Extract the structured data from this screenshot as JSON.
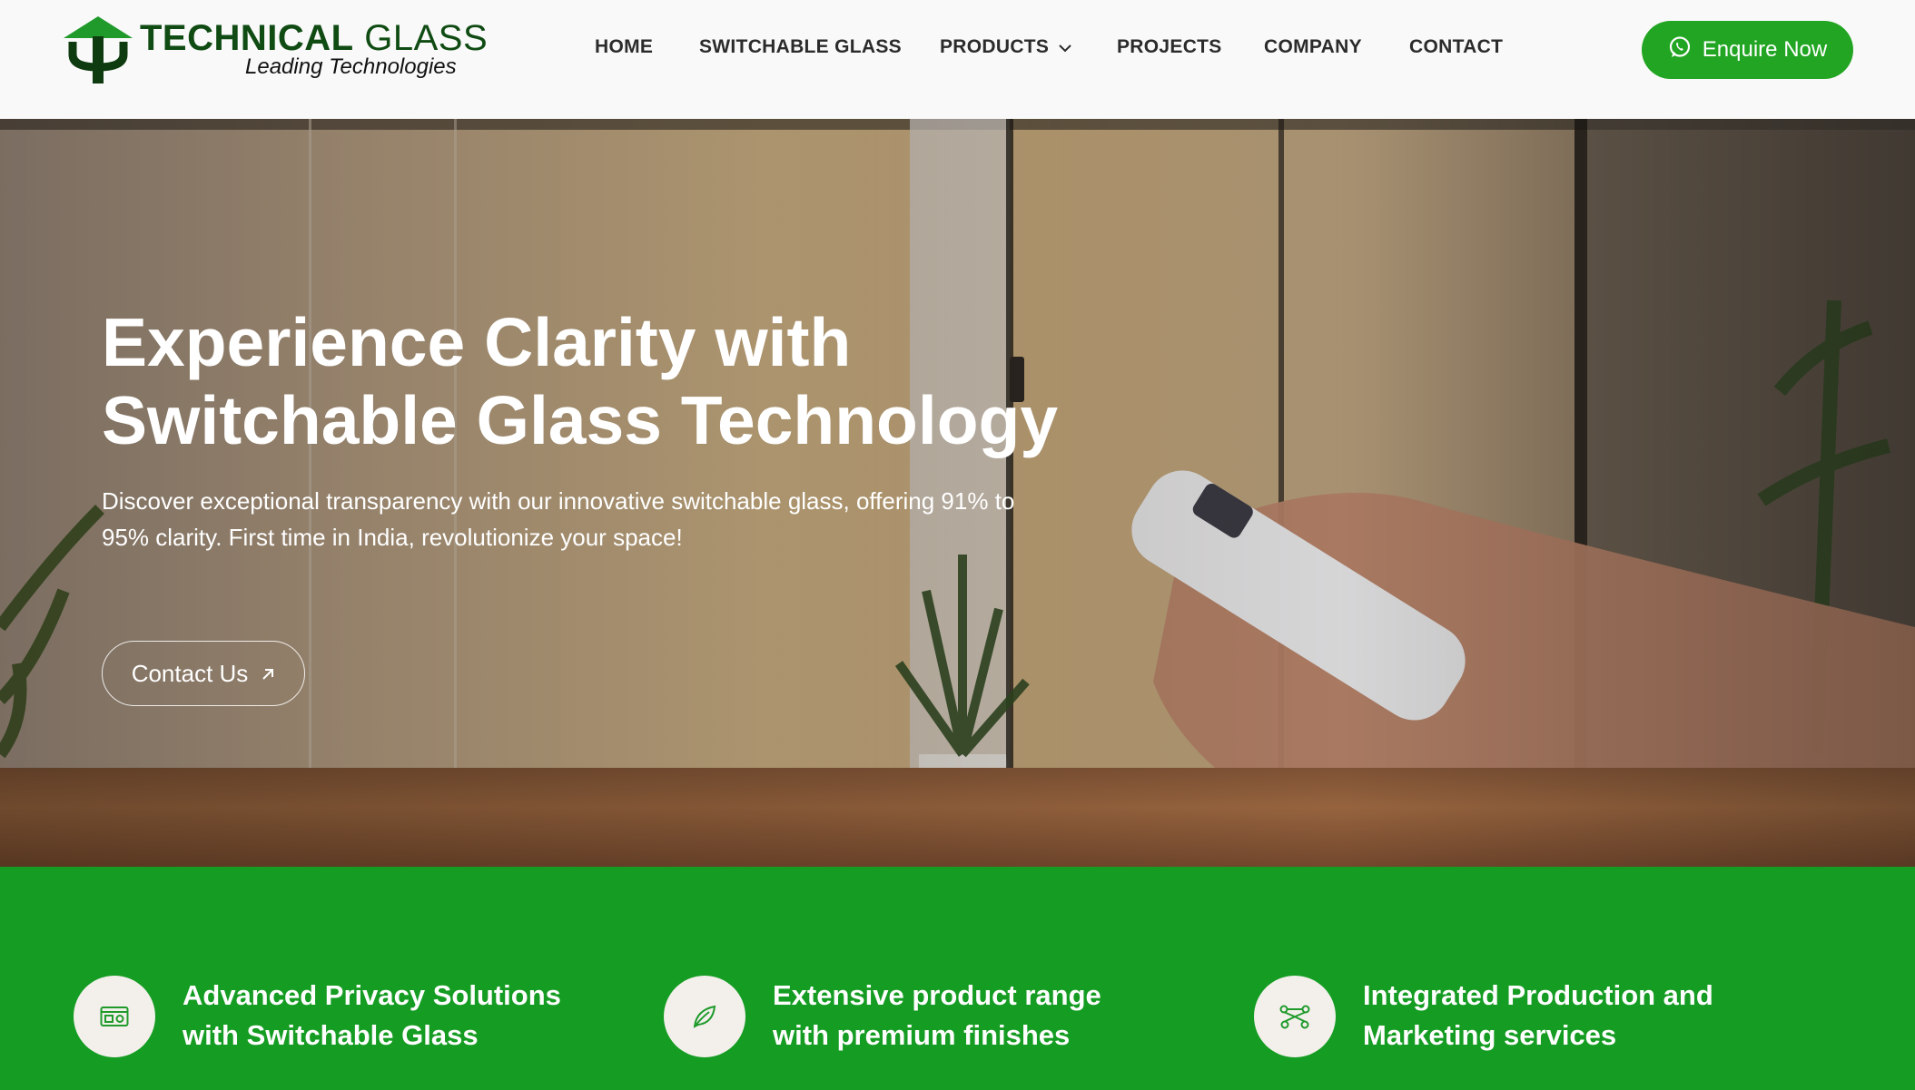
{
  "header": {
    "logo_bold": "TECHNICAL",
    "logo_light": "GLASS",
    "logo_tagline": "Leading Technologies",
    "brand_green": "#0f4b12",
    "nav": [
      {
        "label": "HOME"
      },
      {
        "label": "SWITCHABLE GLASS"
      },
      {
        "label": "PRODUCTS",
        "icon": "chevron-down-icon"
      },
      {
        "label": "PROJECTS"
      },
      {
        "label": "COMPANY"
      },
      {
        "label": "CONTACT"
      }
    ],
    "cta": {
      "label": "Enquire Now",
      "icon": "whatsapp-icon",
      "color": "#21a522"
    }
  },
  "hero": {
    "title_line1": "Experience Clarity with",
    "title_line2": "Switchable Glass Technology",
    "description": "Discover exceptional transparency with our innovative switchable glass, offering 91% to 95% clarity. First time in India, revolutionize your space!",
    "button": {
      "label": "Contact Us",
      "icon": "arrow-up-right-icon"
    }
  },
  "features": {
    "background": "#159c22",
    "items": [
      {
        "line1": "Advanced Privacy Solutions",
        "line2": "with Switchable Glass",
        "icon": "window-panel-icon"
      },
      {
        "line1": "Extensive product range",
        "line2": "with premium finishes",
        "icon": "leaf-icon"
      },
      {
        "line1": "Integrated Production and",
        "line2": "Marketing services",
        "icon": "bezier-curve-icon"
      }
    ]
  }
}
